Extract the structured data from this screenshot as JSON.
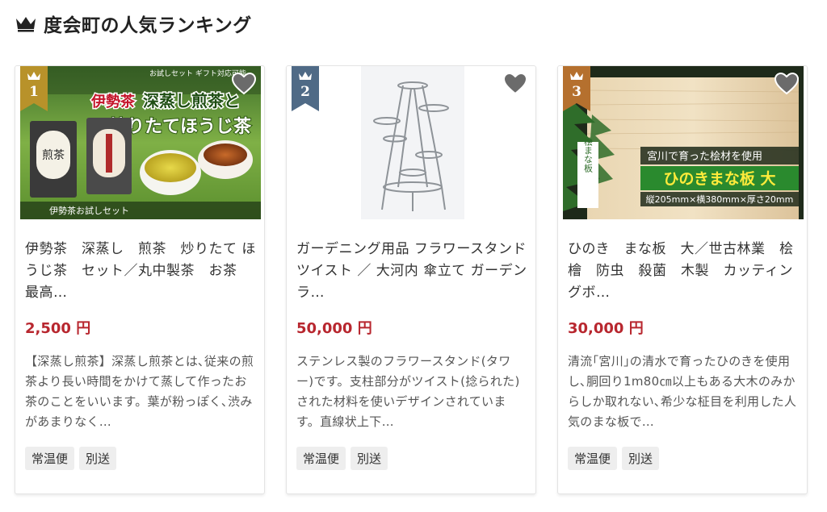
{
  "section": {
    "title": "度会町の人気ランキング"
  },
  "products": [
    {
      "rank": "1",
      "rank_color": "#b8922a",
      "name": "伊勢茶　深蒸し　煎茶　炒りたて ほうじ茶　セット／丸中製茶　お茶　最高…",
      "price": "2,500 円",
      "description": "【深蒸し煎茶】深蒸し煎茶とは､従来の煎茶より長い時間をかけて蒸して作ったお茶のことをいいます。葉が粉っぽく､渋みがあまりなく…",
      "tags": [
        "常温便",
        "別送"
      ],
      "image_text": {
        "top_note": "お試しセット ギフト対応可能",
        "line1": "伊勢茶",
        "line1b": "深蒸し煎茶と",
        "line2": "炒りたてほうじ茶",
        "bottom": "伊勢茶お試しセット",
        "pkg": "煎茶"
      }
    },
    {
      "rank": "2",
      "rank_color": "#4f6a86",
      "name": "ガーデニング用品 フラワースタンド ツイスト ／ 大河内 傘立て ガーデンラ…",
      "price": "50,000 円",
      "description": "ステンレス製のフラワースタンド(タワー)です。支柱部分がツイスト(捻られた)された材料を使いデザインされています。直線状上下…",
      "tags": [
        "常温便",
        "別送"
      ]
    },
    {
      "rank": "3",
      "rank_color": "#b5702e",
      "name": "ひのき　まな板　大／世古林業　桧　檜　防虫　殺菌　木製　カッティングボ…",
      "price": "30,000 円",
      "description": "清流｢宮川｣の清水で育ったひのきを使用し､胴回り1m80㎝以上もある大木のみからしか取れない､希少な柾目を利用した人気のまな板で…",
      "tags": [
        "常温便",
        "別送"
      ],
      "image_text": {
        "banner": "宮川で育った桧材を使用",
        "title": "ひのきまな板 大",
        "size": "縦205mm×横380mm×厚さ20mm",
        "label": "桧まな板"
      }
    }
  ]
}
